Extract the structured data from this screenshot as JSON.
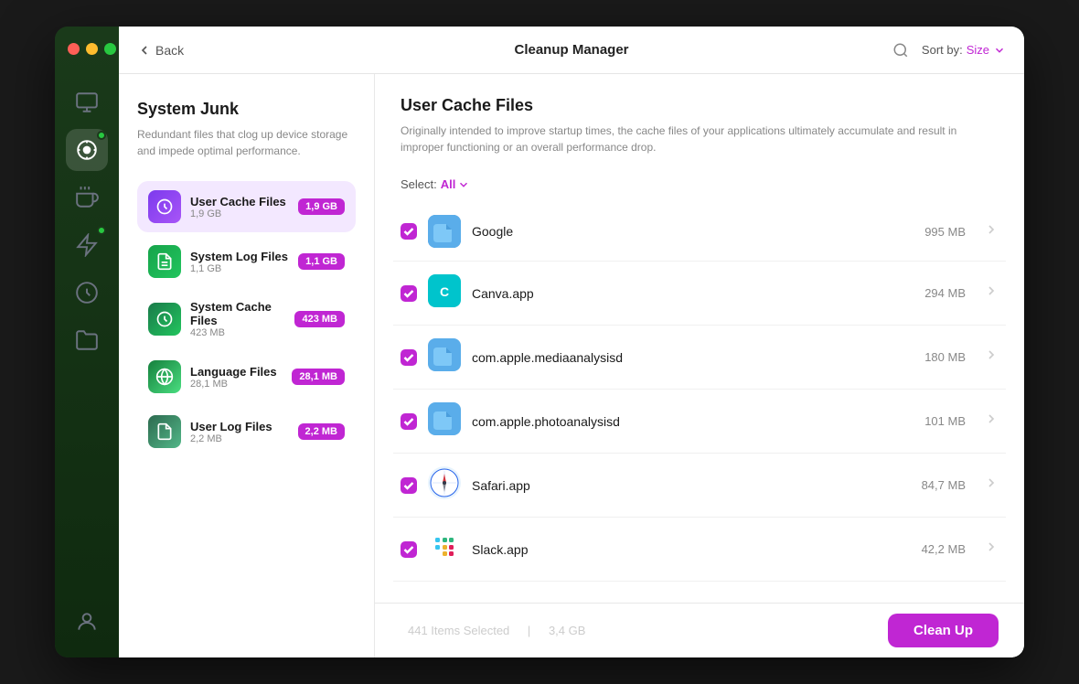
{
  "window": {
    "title": "Cleanup Manager"
  },
  "header": {
    "back_label": "Back",
    "title": "Cleanup Manager",
    "search_label": "search",
    "sort_label": "Sort by:",
    "sort_value": "Size"
  },
  "left_panel": {
    "section_title": "System Junk",
    "section_desc": "Redundant files that clog up device storage and impede optimal performance.",
    "items": [
      {
        "id": "user-cache",
        "name": "User Cache Files",
        "size": "1,9 GB",
        "badge": "1,9 GB",
        "selected": true
      },
      {
        "id": "system-log",
        "name": "System Log Files",
        "size": "1,1 GB",
        "badge": "1,1 GB",
        "selected": false
      },
      {
        "id": "system-cache",
        "name": "System Cache Files",
        "size": "423 MB",
        "badge": "423 MB",
        "selected": false
      },
      {
        "id": "language",
        "name": "Language Files",
        "size": "28,1 MB",
        "badge": "28,1 MB",
        "selected": false
      },
      {
        "id": "user-log",
        "name": "User Log Files",
        "size": "2,2 MB",
        "badge": "2,2 MB",
        "selected": false
      }
    ]
  },
  "right_panel": {
    "title": "User Cache Files",
    "desc": "Originally intended to improve startup times, the cache files of your applications ultimately accumulate and result in improper functioning or an overall performance drop.",
    "select_label": "Select:",
    "select_value": "All",
    "files": [
      {
        "name": "Google",
        "size": "995 MB",
        "icon_type": "folder",
        "checked": true
      },
      {
        "name": "Canva.app",
        "size": "294 MB",
        "icon_type": "canva",
        "checked": true
      },
      {
        "name": "com.apple.mediaanalysisd",
        "size": "180 MB",
        "icon_type": "folder",
        "checked": true
      },
      {
        "name": "com.apple.photoanalysisd",
        "size": "101 MB",
        "icon_type": "folder",
        "checked": true
      },
      {
        "name": "Safari.app",
        "size": "84,7 MB",
        "icon_type": "safari",
        "checked": true
      },
      {
        "name": "Slack.app",
        "size": "42,2 MB",
        "icon_type": "slack",
        "checked": true
      }
    ]
  },
  "footer": {
    "items_selected": "441 Items Selected",
    "total_size": "3,4 GB",
    "cleanup_label": "Clean Up"
  },
  "sidebar": {
    "items": [
      {
        "id": "monitor",
        "icon": "monitor"
      },
      {
        "id": "cleaner",
        "icon": "cleaner",
        "active": true,
        "badge": true
      },
      {
        "id": "privacy",
        "icon": "privacy"
      },
      {
        "id": "optimizer",
        "icon": "optimizer",
        "badge": true
      },
      {
        "id": "updater",
        "icon": "updater"
      },
      {
        "id": "files",
        "icon": "files"
      }
    ]
  }
}
